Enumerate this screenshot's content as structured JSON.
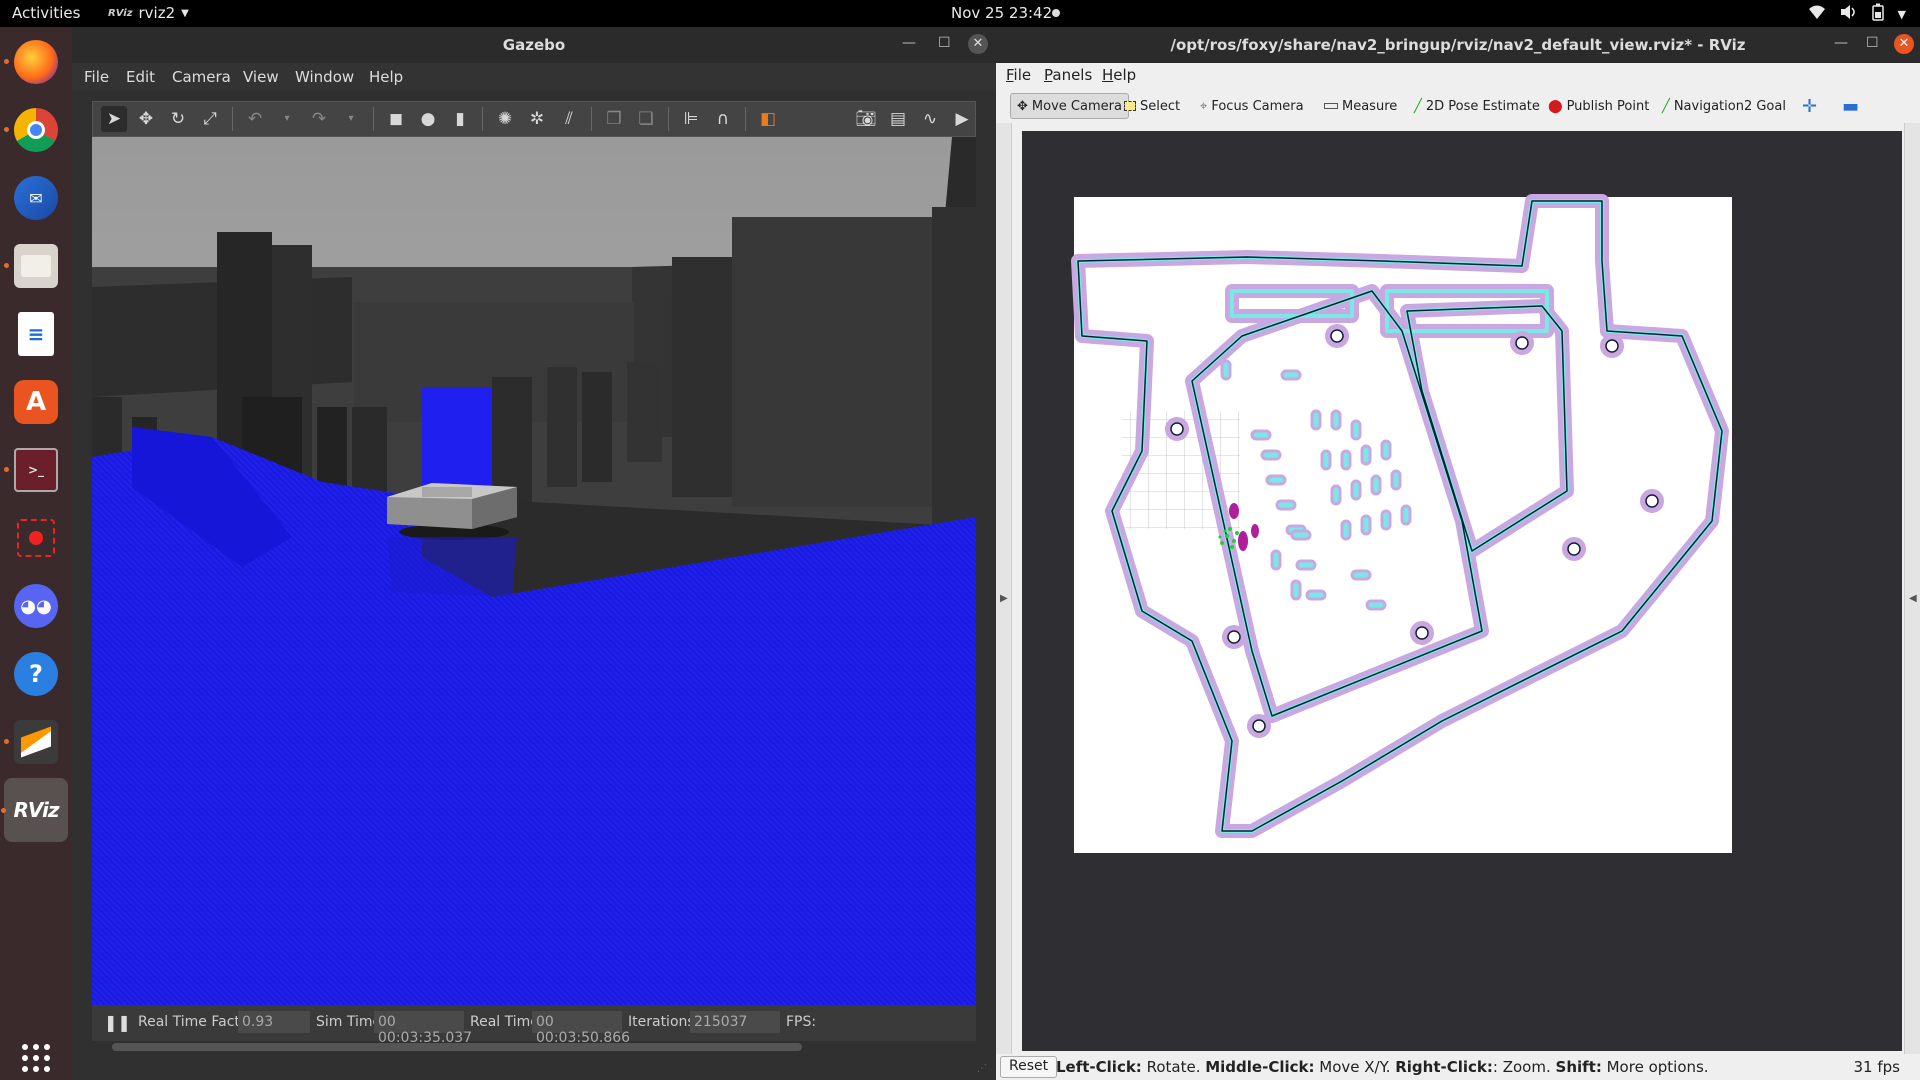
{
  "topbar": {
    "activities": "Activities",
    "app_name": "rviz2",
    "app_badge": "RViz",
    "clock": "Nov 25  23:42"
  },
  "dock": {
    "items": [
      "firefox-icon",
      "chrome-icon",
      "thunderbird-icon",
      "files-icon",
      "writer-icon",
      "software-icon",
      "terminal-icon",
      "recorder-icon",
      "discord-icon",
      "help-icon",
      "sublime-icon",
      "rviz-icon",
      "apps-grid-icon"
    ],
    "rviz_label": "RViz"
  },
  "gazebo": {
    "title": "Gazebo",
    "menu": [
      "File",
      "Edit",
      "Camera",
      "View",
      "Window",
      "Help"
    ],
    "status": {
      "rtf_label": "Real Time Factor:",
      "rtf_value": "0.93",
      "sim_label": "Sim Time:",
      "sim_value": "00 00:03:35.037",
      "real_label": "Real Time:",
      "real_value": "00 00:03:50.866",
      "iter_label": "Iterations:",
      "iter_value": "215037",
      "fps_label": "FPS:"
    }
  },
  "rviz": {
    "title": "/opt/ros/foxy/share/nav2_bringup/rviz/nav2_default_view.rviz* - RViz",
    "menu": [
      "File",
      "Panels",
      "Help"
    ],
    "tools": [
      "Move Camera",
      "Select",
      "Focus Camera",
      "Measure",
      "2D Pose Estimate",
      "Publish Point",
      "Navigation2 Goal"
    ],
    "active_tool": "Move Camera",
    "reset": "Reset",
    "hint": {
      "left_k": "Left-Click:",
      "left_v": " Rotate. ",
      "mid_k": "Middle-Click:",
      "mid_v": " Move X/Y. ",
      "right_k": "Right-Click:",
      "right_v": ": Zoom. ",
      "shift_k": "Shift:",
      "shift_v": " More options."
    },
    "fps": "31 fps"
  },
  "colors": {
    "accent_orange": "#e86a2d",
    "laser_blue": "#1a1ae6",
    "costmap_purple": "#c9a7e0",
    "inflation_cyan": "#7ae8e6"
  }
}
